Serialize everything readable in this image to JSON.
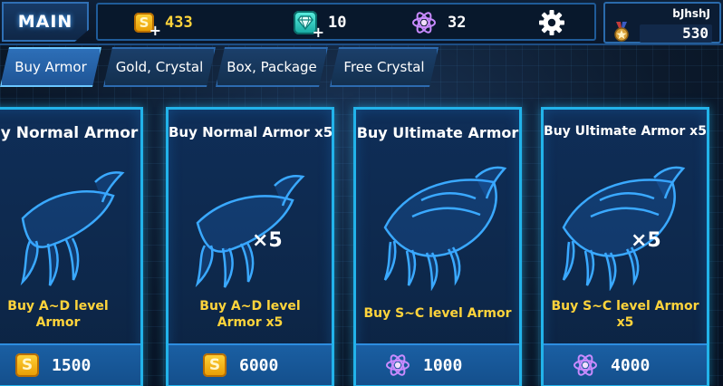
{
  "topbar": {
    "main_label": "MAIN",
    "gold": "433",
    "crystal": "10",
    "energy": "32",
    "coin_symbol": "S"
  },
  "profile": {
    "name": "bJhshJ",
    "score": "530"
  },
  "tabs": [
    {
      "label": "Buy Armor",
      "active": true
    },
    {
      "label": "Gold, Crystal",
      "active": false
    },
    {
      "label": "Box, Package",
      "active": false
    },
    {
      "label": "Free Crystal",
      "active": false
    }
  ],
  "cards": [
    {
      "title": "Buy Normal Armor",
      "multiplier": "",
      "desc": "Buy A~D level\nArmor",
      "price": "1500",
      "currency": "coin-icon"
    },
    {
      "title": "Buy Normal Armor x5",
      "multiplier": "×5",
      "desc": "Buy A~D level\nArmor x5",
      "price": "6000",
      "currency": "coin-icon"
    },
    {
      "title": "Buy Ultimate Armor",
      "multiplier": "",
      "desc": "Buy S~C level Armor",
      "price": "1000",
      "currency": "atom-icon"
    },
    {
      "title": "Buy Ultimate Armor x5",
      "multiplier": "×5",
      "desc": "Buy S~C level Armor\nx5",
      "price": "4000",
      "currency": "atom-icon"
    }
  ],
  "colors": {
    "accent": "#22b3ea",
    "gold": "#ffd43b",
    "crystal": "#3fd9cf",
    "energy": "#b46cff"
  }
}
